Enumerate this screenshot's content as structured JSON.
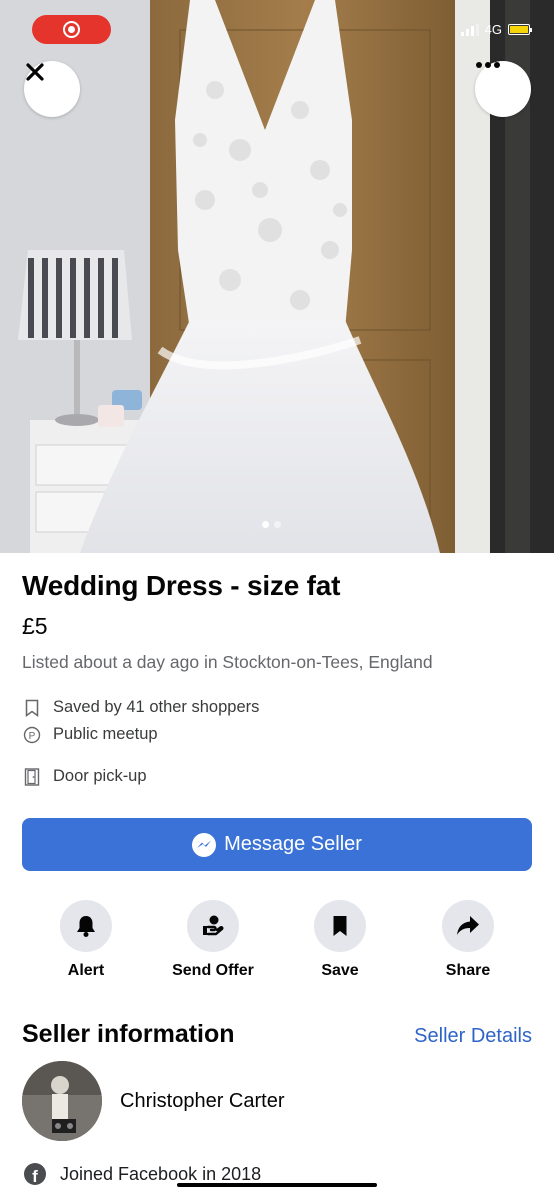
{
  "status_bar": {
    "network": "4G",
    "recording_icon": "screen-record-icon",
    "battery_color": "#f5d40a"
  },
  "photo": {
    "description_icon": "listing-photo",
    "close_icon": "close-icon",
    "more_icon": "more-options-icon",
    "page_indicator": {
      "current": 1,
      "total": 2
    }
  },
  "listing": {
    "title": "Wedding Dress - size fat",
    "price": "£5",
    "listed": "Listed about a day ago in Stockton-on-Tees, England",
    "features": [
      {
        "icon": "bookmark-outline-icon",
        "text": "Saved by 41 other shoppers"
      },
      {
        "icon": "parking-icon",
        "text": "Public meetup"
      },
      {
        "icon": "door-icon",
        "text": "Door pick-up"
      }
    ]
  },
  "message_button": {
    "label": "Message Seller",
    "icon": "messenger-icon",
    "color": "#3a72d8"
  },
  "actions": [
    {
      "icon": "bell-icon",
      "label": "Alert"
    },
    {
      "icon": "offer-icon",
      "label": "Send Offer"
    },
    {
      "icon": "bookmark-icon",
      "label": "Save"
    },
    {
      "icon": "share-icon",
      "label": "Share"
    }
  ],
  "seller": {
    "heading": "Seller information",
    "details_link": "Seller Details",
    "name": "Christopher Carter",
    "joined": "Joined Facebook in 2018",
    "link_color": "#2f64c7"
  }
}
